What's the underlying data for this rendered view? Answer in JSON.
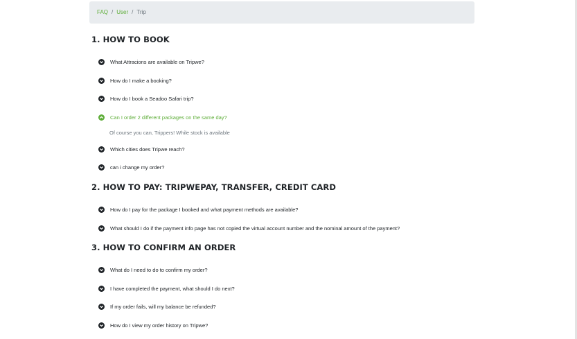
{
  "breadcrumb": {
    "item1": "FAQ",
    "item2": "User",
    "current": "Trip",
    "sep": "/"
  },
  "sections": [
    {
      "title": "1. HOW TO BOOK",
      "questions": [
        "What Attracions are available on Tripwe?",
        "How do I make a booking?",
        "How do I book a Seadoo Safari trip?",
        "Can I order 2 different packages on the same day?",
        "Which cities does Tripwe reach?",
        "can i change my order?"
      ],
      "answer": "Of course you can, Trippers! While stock is available"
    },
    {
      "title": "2. HOW TO PAY: TRIPWEPAY, TRANSFER, CREDIT CARD",
      "questions": [
        "How do I pay for the package I booked and what payment methods are available?",
        "What should I do if the payment info page has not copied the virtual account number and the nominal amount of the payment?"
      ]
    },
    {
      "title": "3. HOW TO CONFIRM AN ORDER",
      "questions": [
        "What do I need to do to confirm my order?",
        "I have completed the payment, what should I do next?",
        "If my order fails, will my balance be refunded?",
        "How do I view my order history on Tripwe?"
      ]
    }
  ],
  "colors": {
    "accent": "#5fae3a",
    "text": "#212529",
    "muted": "#6c757d",
    "breadcrumb_bg": "#e9ecef"
  },
  "icons": {
    "closed": "chevron-down-icon",
    "open": "chevron-up-icon"
  }
}
